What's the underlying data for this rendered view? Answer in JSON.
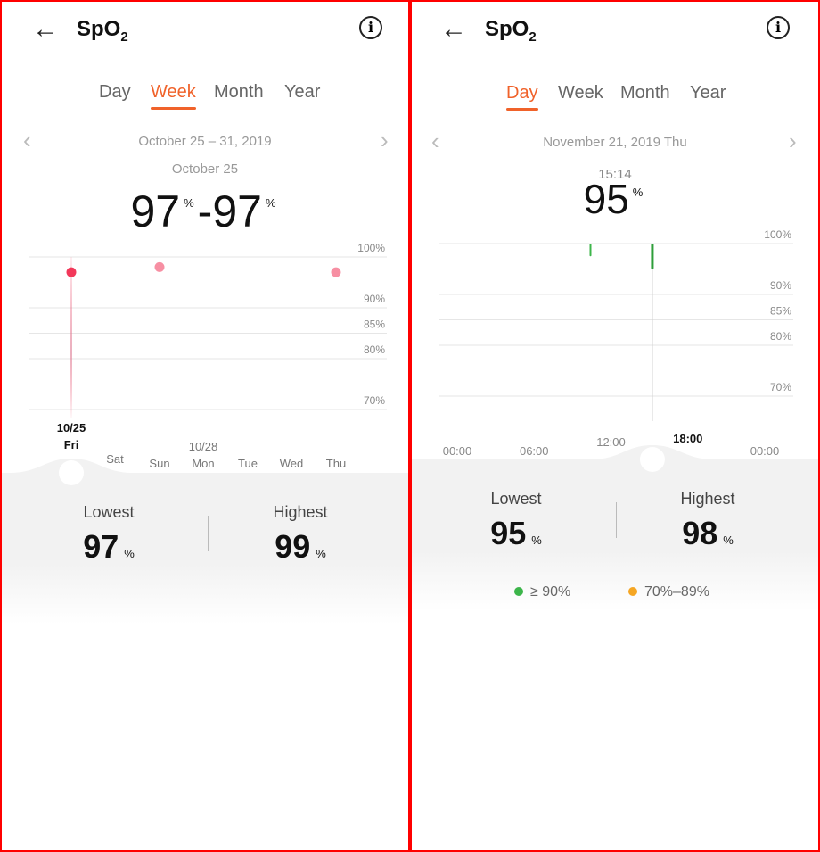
{
  "colors": {
    "accent": "#f0622a",
    "week_point": "#f2385a",
    "week_point_light": "#f78fa3",
    "green": "#3cb54a",
    "green_dark": "#2e9e3a",
    "orange": "#f5a623"
  },
  "week_panel": {
    "title": "SpO",
    "title_sub": "2",
    "tabs": [
      "Day",
      "Week",
      "Month",
      "Year"
    ],
    "active_tab": "Week",
    "range": "October 25 – 31, 2019",
    "selected_date": "October 25",
    "reading_low": "97",
    "reading_high": "97",
    "unit": "%",
    "dash": "-",
    "lowest_label": "Lowest",
    "lowest_value": "97",
    "highest_label": "Highest",
    "highest_value": "99"
  },
  "day_panel": {
    "title": "SpO",
    "title_sub": "2",
    "tabs": [
      "Day",
      "Week",
      "Month",
      "Year"
    ],
    "active_tab": "Day",
    "date": "November 21, 2019 Thu",
    "selected_time": "15:14",
    "reading": "95",
    "unit": "%",
    "lowest_label": "Lowest",
    "lowest_value": "95",
    "highest_label": "Highest",
    "highest_value": "98",
    "legend": [
      {
        "label": "≥ 90%",
        "color": "#3cb54a"
      },
      {
        "label": "70%–89%",
        "color": "#f5a623"
      }
    ]
  },
  "chart_data": [
    {
      "type": "scatter",
      "y_ticks": [
        "100%",
        "90%",
        "85%",
        "80%",
        "70%"
      ],
      "y_tick_values": [
        100,
        90,
        85,
        80,
        70
      ],
      "categories": [
        "Fri",
        "Sat",
        "Sun",
        "Mon",
        "Tue",
        "Wed",
        "Thu"
      ],
      "date_labels": {
        "Fri": "10/25",
        "Mon": "10/28"
      },
      "selected": "Fri",
      "values": [
        97,
        null,
        98,
        null,
        null,
        null,
        97
      ],
      "grid": true
    },
    {
      "type": "bar",
      "y_ticks": [
        "100%",
        "90%",
        "85%",
        "80%",
        "70%"
      ],
      "y_tick_values": [
        100,
        90,
        85,
        80,
        70
      ],
      "x_ticks": [
        "00:00",
        "06:00",
        "12:00",
        "18:00",
        "00:00"
      ],
      "x_tick_hours": [
        0,
        6,
        12,
        18,
        24
      ],
      "selected_x_tick": "18:00",
      "bars": [
        {
          "hour": 10.4,
          "low": 97.5,
          "high": 100
        },
        {
          "hour": 15.23,
          "low": 95,
          "high": 100,
          "selected": true
        }
      ],
      "grid": true
    }
  ]
}
